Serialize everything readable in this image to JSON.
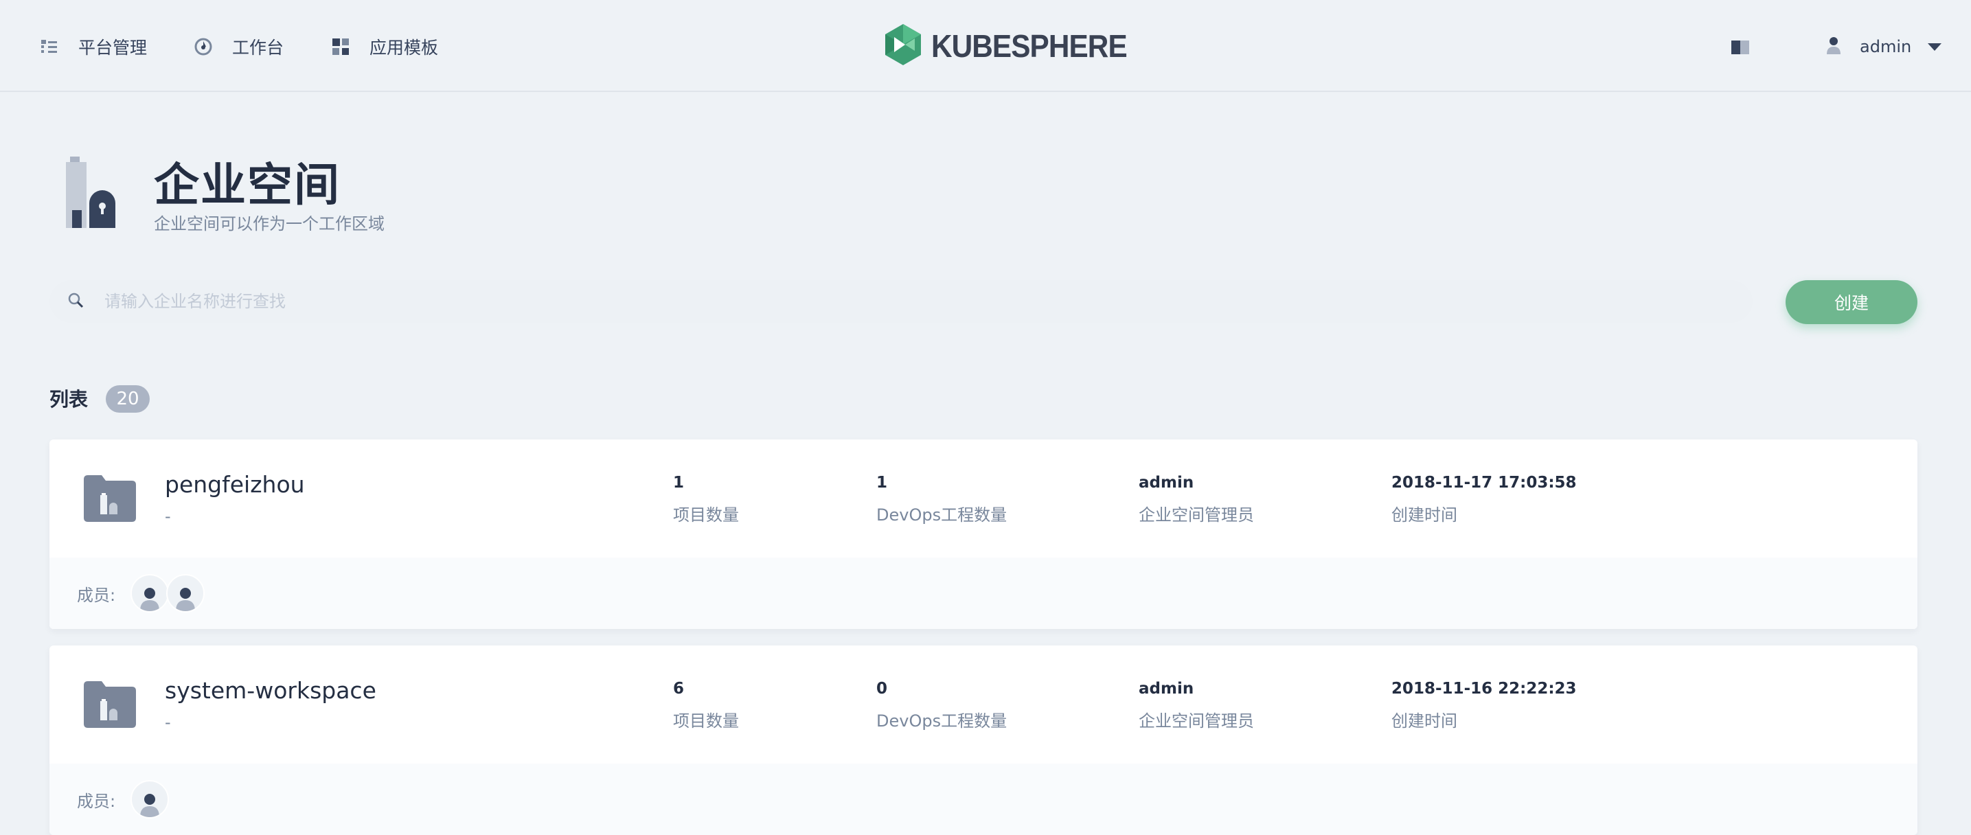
{
  "nav": {
    "items": [
      {
        "label": "平台管理",
        "icon": "list-icon"
      },
      {
        "label": "工作台",
        "icon": "dashboard-icon"
      },
      {
        "label": "应用模板",
        "icon": "apps-icon"
      }
    ],
    "logo_text": "KUBESPHERE",
    "user": {
      "name": "admin"
    }
  },
  "header": {
    "title": "企业空间",
    "description": "企业空间可以作为一个工作区域"
  },
  "search": {
    "placeholder": "请输入企业名称进行查找"
  },
  "create_label": "创建",
  "list": {
    "title": "列表",
    "count": "20",
    "members_label": "成员:",
    "items": [
      {
        "name": "pengfeizhou",
        "desc": "-",
        "projects": "1",
        "projects_label": "项目数量",
        "devops": "1",
        "devops_label": "DevOps工程数量",
        "manager": "admin",
        "manager_label": "企业空间管理员",
        "created": "2018-11-17 17:03:58",
        "created_label": "创建时间",
        "member_count": 2
      },
      {
        "name": "system-workspace",
        "desc": "-",
        "projects": "6",
        "projects_label": "项目数量",
        "devops": "0",
        "devops_label": "DevOps工程数量",
        "manager": "admin",
        "manager_label": "企业空间管理员",
        "created": "2018-11-16 22:22:23",
        "created_label": "创建时间",
        "member_count": 1
      }
    ]
  },
  "colors": {
    "brand_green": "#55bc8a",
    "create_button": "#6fb78f",
    "background": "#eef2f6",
    "text_dark": "#242e42",
    "text_muted": "#79879c"
  }
}
